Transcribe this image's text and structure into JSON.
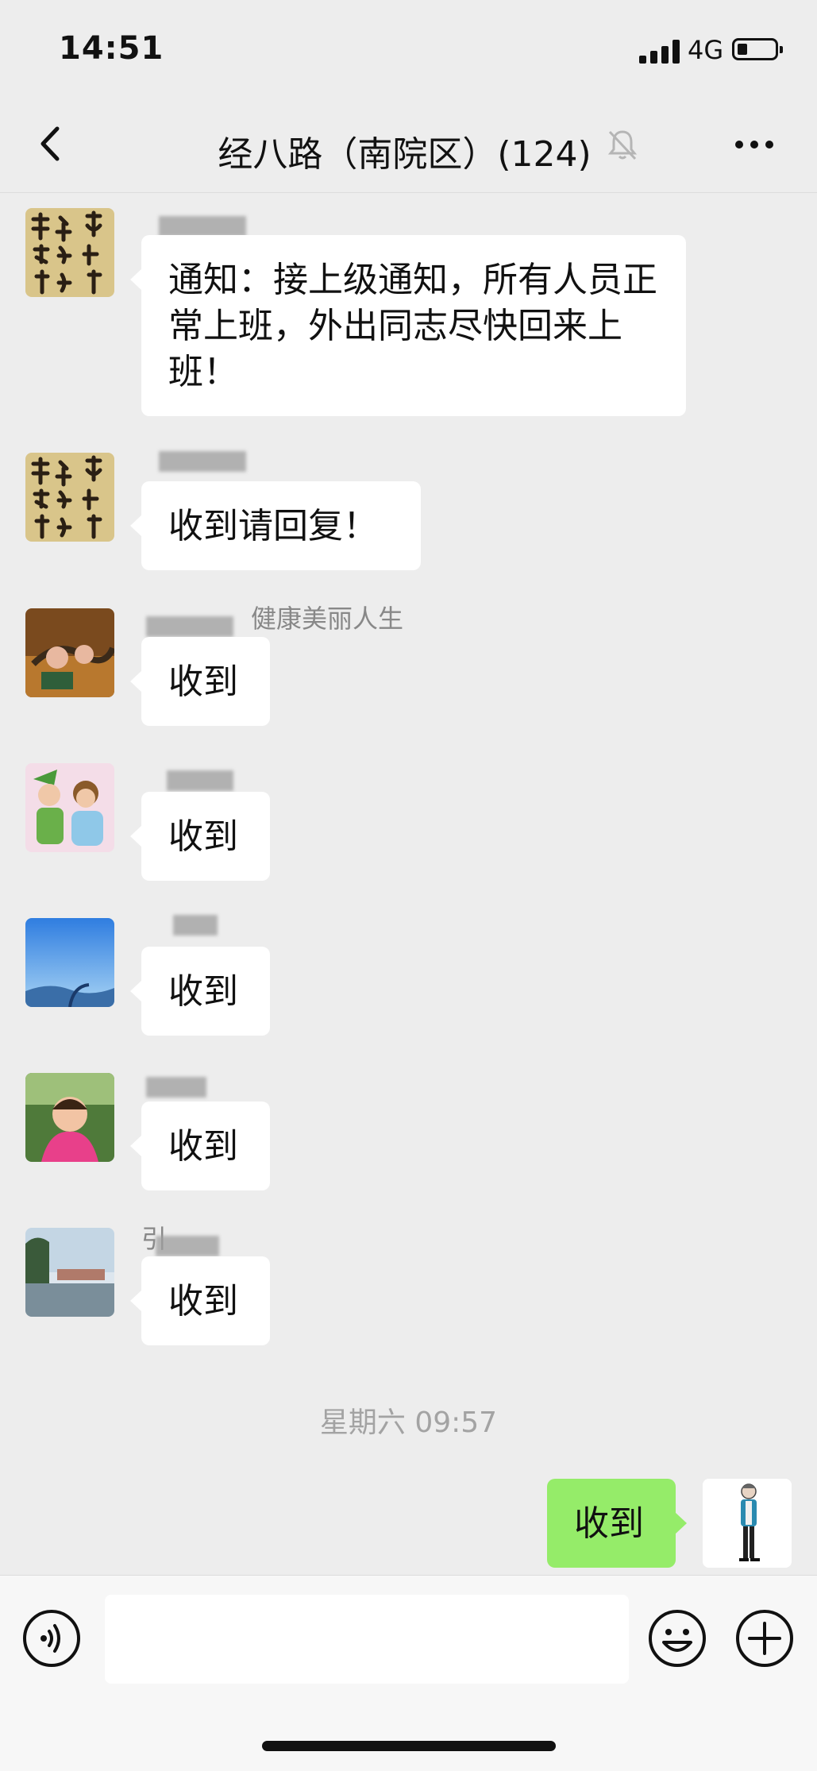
{
  "status_bar": {
    "time": "14:51",
    "network": "4G"
  },
  "header": {
    "title": "经八路（南院区）(124)"
  },
  "messages": [
    {
      "text": "通知：接上级通知，所有人员正常上班，外出同志尽快回来上班！",
      "avatar": "calligraphy"
    },
    {
      "text": "收到请回复！",
      "avatar": "calligraphy"
    },
    {
      "text": "收到",
      "avatar": "autumn-photo",
      "sender_note": "健康美丽人生"
    },
    {
      "text": "收到",
      "avatar": "cartoon"
    },
    {
      "text": "收到",
      "avatar": "sky"
    },
    {
      "text": "收到",
      "avatar": "child-photo"
    },
    {
      "text": "收到",
      "avatar": "lake-photo",
      "sender_note": "引"
    }
  ],
  "timestamp": "星期六 09:57",
  "my_message": {
    "text": "收到"
  },
  "icons": {
    "back": "chevron-left-icon",
    "mute": "bell-off-icon",
    "more": "more-dots-icon",
    "voice": "voice-icon",
    "emoji": "emoji-icon",
    "plus": "plus-icon"
  },
  "colors": {
    "my_bubble": "#95ec69",
    "background": "#ededed"
  }
}
